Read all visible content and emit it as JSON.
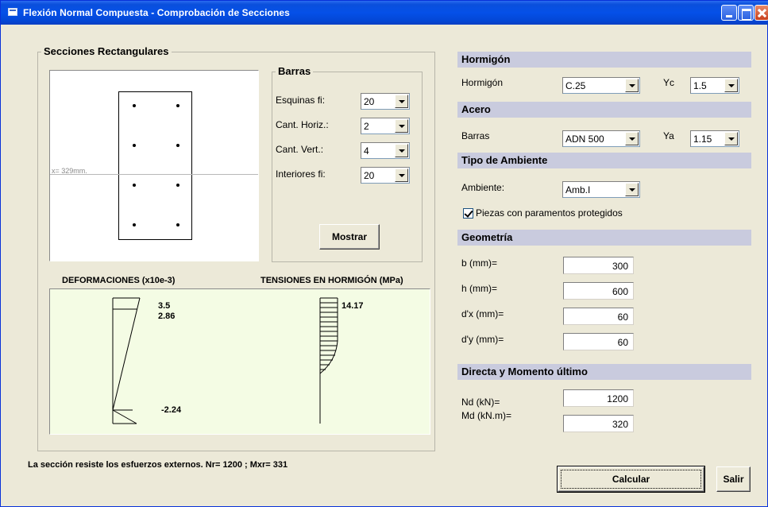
{
  "window": {
    "title": "Flexión Normal Compuesta  - Comprobación de Secciones"
  },
  "section_panel": {
    "legend": "Secciones Rectangulares",
    "neutral_axis_label": "x= 329mm.",
    "barras": {
      "legend": "Barras",
      "rows": [
        {
          "label": "Esquinas fi:",
          "value": "20"
        },
        {
          "label": "Cant. Horiz.:",
          "value": "2"
        },
        {
          "label": "Cant. Vert.:",
          "value": "4"
        },
        {
          "label": "Interiores fi:",
          "value": "20"
        }
      ],
      "show_button": "Mostrar"
    }
  },
  "diagrams": {
    "deformaciones_title": "DEFORMACIONES (x10e-3)",
    "tensiones_title": "TENSIONES EN HORMIGÓN (MPa)",
    "strain_top": "3.5",
    "strain_second": "2.86",
    "strain_bottom": "-2.24",
    "stress_top": "14.17",
    "background_color": "#f4fce4"
  },
  "status_message": "La sección resiste los esfuerzos externos. Nr= 1200 ; Mxr= 331",
  "hormigon": {
    "header": "Hormigón",
    "label": "Hormigón",
    "value": "C.25",
    "gamma_label": "Yc",
    "gamma_value": "1.5"
  },
  "acero": {
    "header": "Acero",
    "label": "Barras",
    "value": "ADN 500",
    "gamma_label": "Ya",
    "gamma_value": "1.15"
  },
  "ambiente": {
    "header": "Tipo de Ambiente",
    "label": "Ambiente:",
    "value": "Amb.I",
    "checkbox_label": "Piezas con paramentos protegidos",
    "checked": true
  },
  "geometria": {
    "header": "Geometría",
    "fields": [
      {
        "label": "b (mm)=",
        "value": "300"
      },
      {
        "label": "h (mm)=",
        "value": "600"
      },
      {
        "label": "d'x (mm)=",
        "value": "60"
      },
      {
        "label": "d'y (mm)=",
        "value": "60"
      }
    ]
  },
  "esfuerzos": {
    "header": "Directa y Momento último",
    "fields": [
      {
        "label": "Nd (kN)=",
        "value": "1200"
      },
      {
        "label": "Md (kN.m)=",
        "value": "320"
      }
    ]
  },
  "buttons": {
    "calcular": "Calcular",
    "salir": "Salir"
  },
  "colors": {
    "titlebar": "#0550e8",
    "section_header": "#c9cbde",
    "dialog": "#ece9d8"
  }
}
